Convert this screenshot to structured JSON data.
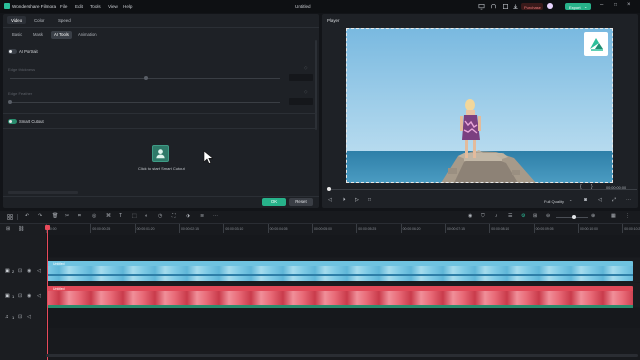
{
  "app": {
    "name": "Wondershare Filmora",
    "menu": [
      "File",
      "Edit",
      "Tools",
      "View",
      "Help"
    ],
    "project_title": "Untitled",
    "purchase_label": "Purchase",
    "export_label": "Export"
  },
  "properties": {
    "tabs": [
      "Video",
      "Color",
      "Speed"
    ],
    "active_tab": "Video",
    "subtabs": [
      "Basic",
      "Mask",
      "AI Tools",
      "Animation"
    ],
    "active_subtab": "AI Tools",
    "ai_portrait_label": "AI Portrait",
    "edge_thickness_label": "Edge thickness",
    "edge_feather_label": "Edge Feather",
    "smart_cutout_label": "Smart Cutout",
    "smart_cutout_hint": "Click to start Smart Cutout",
    "ok_label": "OK",
    "reset_label": "Reset"
  },
  "player": {
    "title": "Player",
    "timecode": "00:00:00:00",
    "quality": "Full Quality"
  },
  "timeline": {
    "ruler": [
      "00:00",
      "00:00:00:25",
      "00:00:01:20",
      "00:00:02:15",
      "00:00:03:10",
      "00:00:04:05",
      "00:00:05:00",
      "00:00:05:25",
      "00:00:06:20",
      "00:00:07:15",
      "00:00:08:10",
      "00:00:09:05",
      "00:00:10:00",
      "00:00:10:25"
    ],
    "track2_clip": "Untitled",
    "track1_clip": "Untitled",
    "track_numbers": [
      "2",
      "1",
      "1"
    ]
  },
  "colors": {
    "accent": "#27b28a",
    "purchase": "#3a1a1a",
    "clip_blue": "#6fc3e0",
    "clip_red": "#e04a59",
    "playhead": "#e84a5a"
  }
}
